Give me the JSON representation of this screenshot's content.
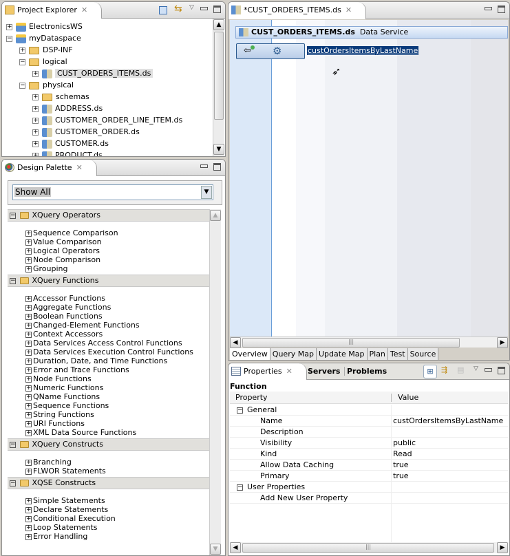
{
  "project_explorer": {
    "title": "Project Explorer",
    "tree": [
      {
        "label": "ElectronicsWS",
        "level": 0,
        "exp": "+"
      },
      {
        "label": "myDataspace",
        "level": 0,
        "exp": "-"
      },
      {
        "label": "DSP-INF",
        "level": 1,
        "exp": "+",
        "type": "folder"
      },
      {
        "label": "logical",
        "level": 1,
        "exp": "-",
        "type": "folder"
      },
      {
        "label": "CUST_ORDERS_ITEMS.ds",
        "level": 2,
        "exp": "+",
        "type": "ds",
        "selected": true
      },
      {
        "label": "physical",
        "level": 1,
        "exp": "-",
        "type": "folder"
      },
      {
        "label": "schemas",
        "level": 2,
        "exp": "+",
        "type": "folder"
      },
      {
        "label": "ADDRESS.ds",
        "level": 2,
        "exp": "+",
        "type": "ds"
      },
      {
        "label": "CUSTOMER_ORDER_LINE_ITEM.ds",
        "level": 2,
        "exp": "+",
        "type": "ds"
      },
      {
        "label": "CUSTOMER_ORDER.ds",
        "level": 2,
        "exp": "+",
        "type": "ds"
      },
      {
        "label": "CUSTOMER.ds",
        "level": 2,
        "exp": "+",
        "type": "ds"
      },
      {
        "label": "PRODUCT.ds",
        "level": 2,
        "exp": "+",
        "type": "ds"
      }
    ]
  },
  "design_palette": {
    "title": "Design Palette",
    "filter": "Show All",
    "groups": [
      {
        "label": "XQuery Operators",
        "items": [
          "Sequence Comparison",
          "Value Comparison",
          "Logical Operators",
          "Node Comparison",
          "Grouping"
        ]
      },
      {
        "label": "XQuery Functions",
        "items": [
          "Accessor Functions",
          "Aggregate Functions",
          "Boolean Functions",
          "Changed-Element Functions",
          "Context Accessors",
          "Data Services Access Control Functions",
          "Data Services Execution Control Functions",
          "Duration, Date, and Time Functions",
          "Error and Trace Functions",
          "Node Functions",
          "Numeric Functions",
          "QName Functions",
          "Sequence Functions",
          "String Functions",
          "URI Functions",
          "XML Data Source Functions"
        ]
      },
      {
        "label": "XQuery Constructs",
        "items": [
          "Branching",
          "FLWOR Statements"
        ]
      },
      {
        "label": "XQSE Constructs",
        "items": [
          "Simple Statements",
          "Declare Statements",
          "Conditional Execution",
          "Loop Statements",
          "Error Handling"
        ]
      }
    ]
  },
  "editor": {
    "tab": "*CUST_ORDERS_ITEMS.ds",
    "service_name": "CUST_ORDERS_ITEMS.ds",
    "service_type": "Data Service",
    "function_name": "custOrdersItemsByLastName",
    "tabs": [
      "Overview",
      "Query Map",
      "Update Map",
      "Plan",
      "Test",
      "Source"
    ],
    "active_tab": "Overview"
  },
  "properties": {
    "tabs": [
      "Properties",
      "Servers",
      "Problems"
    ],
    "section": "Function",
    "col_property": "Property",
    "col_value": "Value",
    "rows": [
      {
        "label": "General",
        "group": true,
        "value": ""
      },
      {
        "label": "Name",
        "value": "custOrdersItemsByLastName"
      },
      {
        "label": "Description",
        "value": ""
      },
      {
        "label": "Visibility",
        "value": "public"
      },
      {
        "label": "Kind",
        "value": "Read"
      },
      {
        "label": "Allow Data Caching",
        "value": "true"
      },
      {
        "label": "Primary",
        "value": "true"
      },
      {
        "label": "User Properties",
        "group": true,
        "value": ""
      },
      {
        "label": "Add New User Property",
        "value": ""
      }
    ]
  }
}
